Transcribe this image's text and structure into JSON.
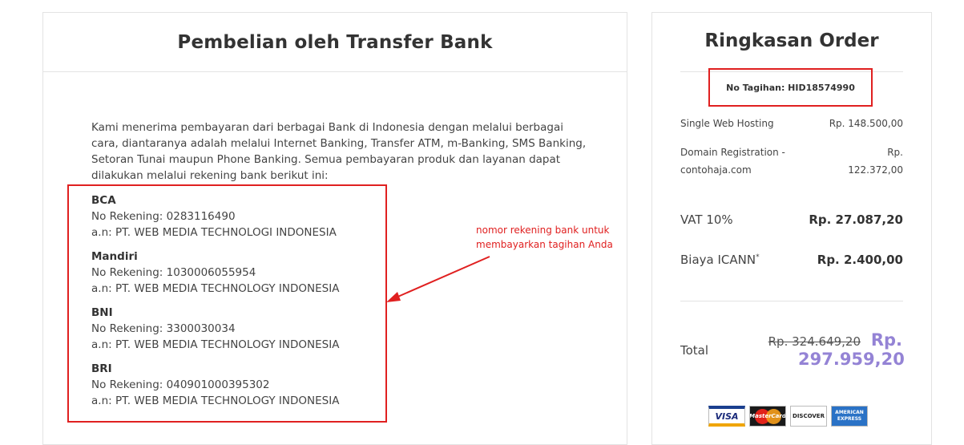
{
  "left": {
    "title": "Pembelian oleh Transfer Bank",
    "intro": "Kami menerima pembayaran dari berbagai Bank di Indonesia dengan melalui berbagai cara, diantaranya adalah melalui Internet Banking, Transfer ATM, m-Banking, SMS Banking, Setoran Tunai maupun Phone Banking. Semua pembayaran produk dan layanan dapat dilakukan melalui rekening bank berikut ini:",
    "banks": [
      {
        "name": "BCA",
        "account": "No Rekening: 0283116490",
        "holder": "a.n: PT. WEB MEDIA TECHNOLOGI INDONESIA"
      },
      {
        "name": "Mandiri",
        "account": "No Rekening: 1030006055954",
        "holder": "a.n: PT. WEB MEDIA TECHNOLOGY INDONESIA"
      },
      {
        "name": "BNI",
        "account": "No Rekening: 3300030034",
        "holder": "a.n: PT. WEB MEDIA TECHNOLOGY INDONESIA"
      },
      {
        "name": "BRI",
        "account": "No Rekening: 040901000395302",
        "holder": "a.n: PT. WEB MEDIA TECHNOLOGY INDONESIA"
      }
    ],
    "annotation_line1": "nomor rekening bank untuk",
    "annotation_line2": "membayarkan tagihan Anda"
  },
  "summary": {
    "title": "Ringkasan Order",
    "invoice": "No Tagihan: HID18574990",
    "items": [
      {
        "label": "Single Web Hosting",
        "value": "Rp. 148.500,00"
      },
      {
        "label1": "Domain Registration -",
        "label2": "contohaja.com",
        "value1": "Rp.",
        "value2": "122.372,00"
      }
    ],
    "vat_label": "VAT 10%",
    "vat_value": "Rp. 27.087,20",
    "icann_label": "Biaya ICANN",
    "icann_sup": "*",
    "icann_value": "Rp. 2.400,00",
    "total_label": "Total",
    "total_old": "Rp. 324.649,20",
    "total_new_line1": "Rp.",
    "total_new_line2": "297.959,20",
    "cards": [
      "VISA",
      "MasterCard",
      "DISCOVER",
      "AMERICAN EXPRESS"
    ]
  },
  "colors": {
    "highlight": "#e02020",
    "total_accent": "#9483d5"
  }
}
